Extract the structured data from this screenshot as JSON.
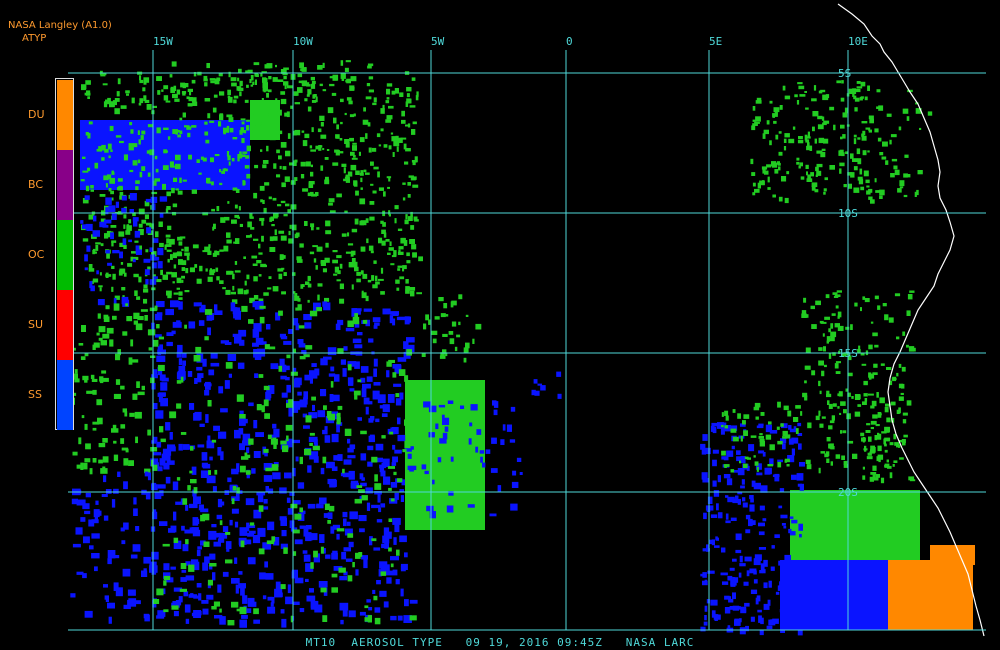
{
  "header": {
    "source": "NASA Langley (A1.0)",
    "product": "ATYP"
  },
  "legend": [
    {
      "code": "DU",
      "color": "#ff8800"
    },
    {
      "code": "BC",
      "color": "#880088"
    },
    {
      "code": "OC",
      "color": "#00bb00"
    },
    {
      "code": "SU",
      "color": "#ff0000"
    },
    {
      "code": "SS",
      "color": "#0044ff"
    }
  ],
  "grid": {
    "color": "#4fd9d9",
    "longitudes": [
      "15W",
      "10W",
      "5W",
      "0",
      "5E",
      "10E"
    ],
    "latitudes": [
      "5S",
      "10S",
      "15S",
      "20S"
    ]
  },
  "footer": {
    "text": "MT10  AEROSOL TYPE   09 19, 2016 09:45Z   NASA LARC"
  },
  "colors": {
    "background": "#000000",
    "coastline": "#ffffff",
    "organic_carbon": "#22cc22",
    "sea_salt": "#0a14ff",
    "dust": "#ff8800"
  }
}
